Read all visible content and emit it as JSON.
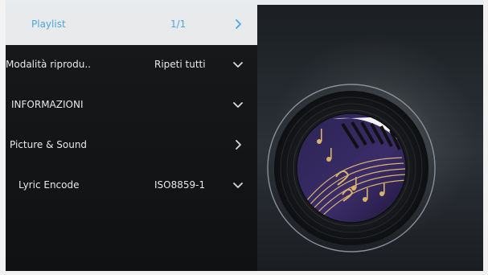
{
  "menu": {
    "items": [
      {
        "label": "Playlist",
        "value": "1/1",
        "icon": "chevron-right-icon"
      },
      {
        "label": "Modalità riprodu..",
        "value": "Ripeti tutti",
        "icon": "chevron-down-icon"
      },
      {
        "label": "INFORMAZIONI",
        "value": "",
        "icon": "chevron-down-icon"
      },
      {
        "label": "Picture & Sound",
        "value": "",
        "icon": "chevron-right-icon"
      },
      {
        "label": "Lyric Encode",
        "value": "ISO8859-1",
        "icon": "chevron-down-icon"
      }
    ]
  },
  "colors": {
    "selected_background": "#e9eaec",
    "selected_text": "#4aa7de",
    "menu_background": "#121416",
    "menu_text": "#e8e8e8"
  },
  "album_art": {
    "icon": "vinyl-record-icon"
  }
}
